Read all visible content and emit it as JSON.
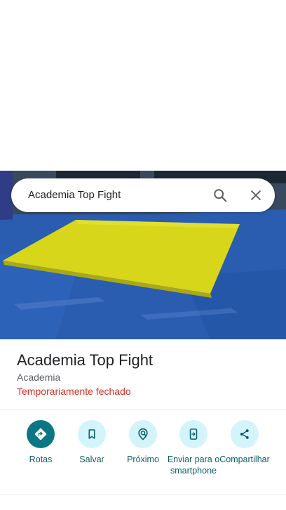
{
  "search": {
    "query": "Academia Top Fight"
  },
  "place": {
    "title": "Academia Top Fight",
    "category": "Academia",
    "status": "Temporariamente fechado"
  },
  "actions": [
    {
      "label": "Rotas",
      "icon": "directions-icon"
    },
    {
      "label": "Salvar",
      "icon": "bookmark-icon"
    },
    {
      "label": "Próximo",
      "icon": "nearby-icon"
    },
    {
      "label": "Enviar para o smartphone",
      "icon": "send-to-phone-icon"
    },
    {
      "label": "Compartilhar",
      "icon": "share-icon"
    }
  ],
  "colors": {
    "accent": "#0b7785",
    "action_bg": "#d3f4fb",
    "status_closed": "#d93025",
    "mat_yellow": "#d9d91a",
    "mat_blue": "#2a5db0"
  }
}
